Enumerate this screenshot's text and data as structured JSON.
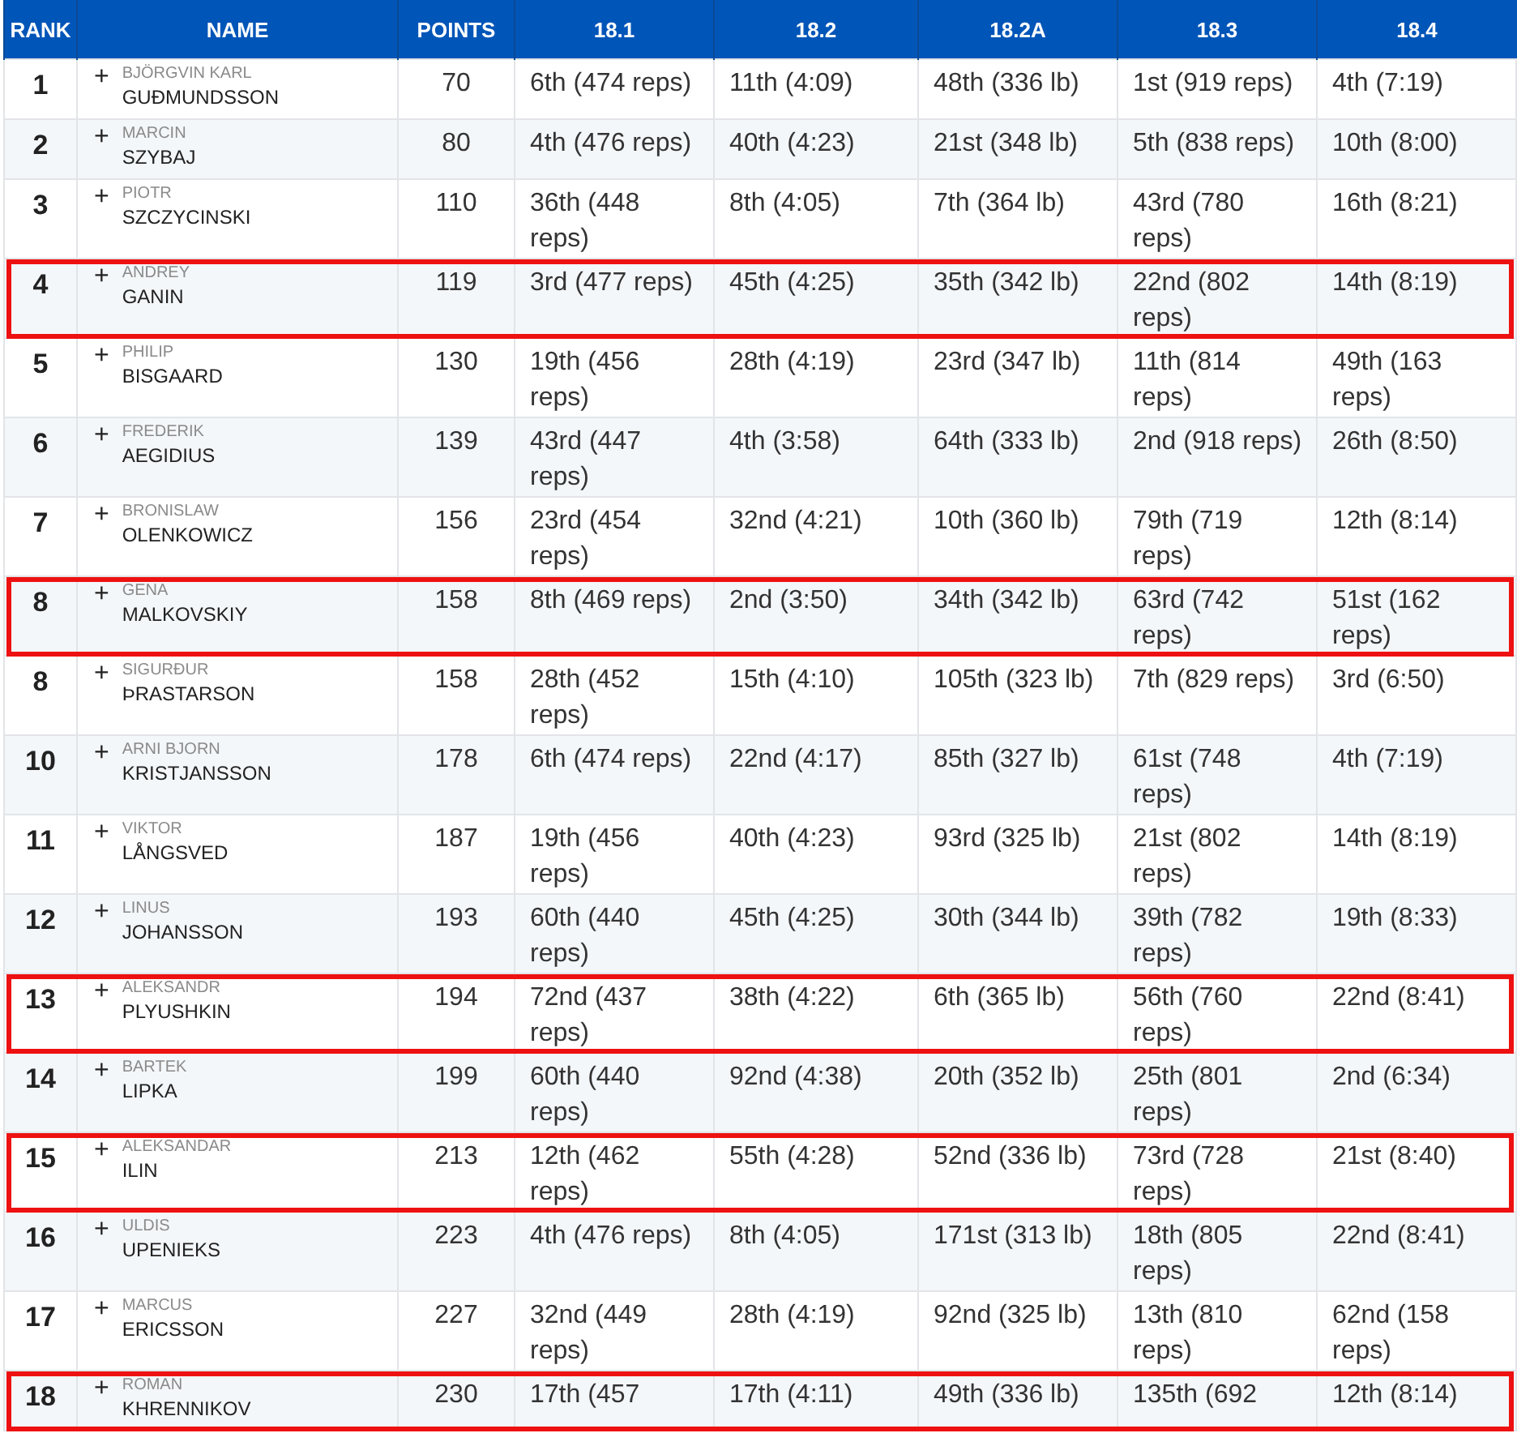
{
  "table": {
    "columns": [
      "RANK",
      "NAME",
      "POINTS",
      "18.1",
      "18.2",
      "18.2A",
      "18.3",
      "18.4"
    ],
    "rows": [
      {
        "rank": "1",
        "expand": "+",
        "first_name": "BJÖRGVIN KARL",
        "last_name": "GUÐMUNDSSON",
        "points": "70",
        "scores": [
          "6th (474 reps)",
          "11th (4:09)",
          "48th (336 lb)",
          "1st (919 reps)",
          "4th (7:19)"
        ],
        "highlighted": false
      },
      {
        "rank": "2",
        "expand": "+",
        "first_name": "MARCIN",
        "last_name": "SZYBAJ",
        "points": "80",
        "scores": [
          "4th (476 reps)",
          "40th (4:23)",
          "21st (348 lb)",
          "5th (838 reps)",
          "10th (8:00)"
        ],
        "highlighted": false
      },
      {
        "rank": "3",
        "expand": "+",
        "first_name": "PIOTR",
        "last_name": "SZCZYCINSKI",
        "points": "110",
        "scores": [
          "36th (448 reps)",
          "8th (4:05)",
          "7th (364 lb)",
          "43rd (780 reps)",
          "16th (8:21)"
        ],
        "highlighted": false
      },
      {
        "rank": "4",
        "expand": "+",
        "first_name": "ANDREY",
        "last_name": "GANIN",
        "points": "119",
        "scores": [
          "3rd (477 reps)",
          "45th (4:25)",
          "35th (342 lb)",
          "22nd (802 reps)",
          "14th (8:19)"
        ],
        "highlighted": true
      },
      {
        "rank": "5",
        "expand": "+",
        "first_name": "PHILIP",
        "last_name": "BISGAARD",
        "points": "130",
        "scores": [
          "19th (456 reps)",
          "28th (4:19)",
          "23rd (347 lb)",
          "11th (814 reps)",
          "49th (163 reps)"
        ],
        "highlighted": false
      },
      {
        "rank": "6",
        "expand": "+",
        "first_name": "FREDERIK",
        "last_name": "AEGIDIUS",
        "points": "139",
        "scores": [
          "43rd (447 reps)",
          "4th (3:58)",
          "64th (333 lb)",
          "2nd (918 reps)",
          "26th (8:50)"
        ],
        "highlighted": false
      },
      {
        "rank": "7",
        "expand": "+",
        "first_name": "BRONISLAW",
        "last_name": "OLENKOWICZ",
        "points": "156",
        "scores": [
          "23rd (454 reps)",
          "32nd (4:21)",
          "10th (360 lb)",
          "79th (719 reps)",
          "12th (8:14)"
        ],
        "highlighted": false
      },
      {
        "rank": "8",
        "expand": "+",
        "first_name": "GENA",
        "last_name": "MALKOVSKIY",
        "points": "158",
        "scores": [
          "8th (469 reps)",
          "2nd (3:50)",
          "34th (342 lb)",
          "63rd (742 reps)",
          "51st (162 reps)"
        ],
        "highlighted": true
      },
      {
        "rank": "8",
        "expand": "+",
        "first_name": "SIGURÐUR",
        "last_name": "ÞRASTARSON",
        "points": "158",
        "scores": [
          "28th (452 reps)",
          "15th (4:10)",
          "105th (323 lb)",
          "7th (829 reps)",
          "3rd (6:50)"
        ],
        "highlighted": false
      },
      {
        "rank": "10",
        "expand": "+",
        "first_name": "ARNI BJORN",
        "last_name": "KRISTJANSSON",
        "points": "178",
        "scores": [
          "6th (474 reps)",
          "22nd (4:17)",
          "85th (327 lb)",
          "61st (748 reps)",
          "4th (7:19)"
        ],
        "highlighted": false
      },
      {
        "rank": "11",
        "expand": "+",
        "first_name": "VIKTOR",
        "last_name": "LÅNGSVED",
        "points": "187",
        "scores": [
          "19th (456 reps)",
          "40th (4:23)",
          "93rd (325 lb)",
          "21st (802 reps)",
          "14th (8:19)"
        ],
        "highlighted": false
      },
      {
        "rank": "12",
        "expand": "+",
        "first_name": "LINUS",
        "last_name": "JOHANSSON",
        "points": "193",
        "scores": [
          "60th (440 reps)",
          "45th (4:25)",
          "30th (344 lb)",
          "39th (782 reps)",
          "19th (8:33)"
        ],
        "highlighted": false
      },
      {
        "rank": "13",
        "expand": "+",
        "first_name": "ALEKSANDR",
        "last_name": "PLYUSHKIN",
        "points": "194",
        "scores": [
          "72nd (437 reps)",
          "38th (4:22)",
          "6th (365 lb)",
          "56th (760 reps)",
          "22nd (8:41)"
        ],
        "highlighted": true
      },
      {
        "rank": "14",
        "expand": "+",
        "first_name": "BARTEK",
        "last_name": "LIPKA",
        "points": "199",
        "scores": [
          "60th (440 reps)",
          "92nd (4:38)",
          "20th (352 lb)",
          "25th (801 reps)",
          "2nd (6:34)"
        ],
        "highlighted": false
      },
      {
        "rank": "15",
        "expand": "+",
        "first_name": "ALEKSANDAR",
        "last_name": "ILIN",
        "points": "213",
        "scores": [
          "12th (462 reps)",
          "55th (4:28)",
          "52nd (336 lb)",
          "73rd (728 reps)",
          "21st (8:40)"
        ],
        "highlighted": true
      },
      {
        "rank": "16",
        "expand": "+",
        "first_name": "ULDIS",
        "last_name": "UPENIEKS",
        "points": "223",
        "scores": [
          "4th (476 reps)",
          "8th (4:05)",
          "171st (313 lb)",
          "18th (805 reps)",
          "22nd (8:41)"
        ],
        "highlighted": false
      },
      {
        "rank": "17",
        "expand": "+",
        "first_name": "MARCUS",
        "last_name": "ERICSSON",
        "points": "227",
        "scores": [
          "32nd (449 reps)",
          "28th (4:19)",
          "92nd (325 lb)",
          "13th (810 reps)",
          "62nd (158 reps)"
        ],
        "highlighted": false
      },
      {
        "rank": "18",
        "expand": "+",
        "first_name": "ROMAN",
        "last_name": "KHRENNIKOV",
        "points": "230",
        "scores": [
          "17th (457",
          "17th (4:11)",
          "49th (336 lb)",
          "135th (692",
          "12th (8:14)"
        ],
        "highlighted": true
      }
    ]
  }
}
